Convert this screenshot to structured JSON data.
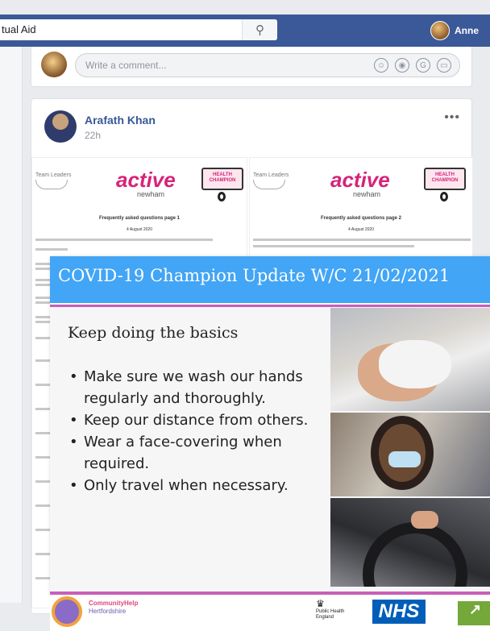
{
  "topbar": {
    "search_value": "tual Aid",
    "search_icon": "search-icon",
    "profile_name": "Anne",
    "color": "#3b5998"
  },
  "comment": {
    "placeholder": "Write a comment...",
    "icons": [
      "emoji-icon",
      "camera-icon",
      "gif-icon",
      "sticker-icon"
    ]
  },
  "post": {
    "author": "Arafath Khan",
    "time": "22h",
    "more": "•••"
  },
  "doc_preview": {
    "brand": "active",
    "brand_sub": "newham",
    "left_logo": "Team Leaders",
    "champion_label": "HEALTH CHAMPION",
    "heading_1": "Frequently asked questions page 1",
    "heading_2": "Frequently asked questions page 2",
    "date": "4 August 2020",
    "brand_color": "#d6247a"
  },
  "slide": {
    "title": "COVID-19 Champion Update W/C 21/02/2021",
    "subtitle": "Keep doing the basics",
    "bullets": [
      "Make sure we wash our hands regularly and thoroughly.",
      "Keep our distance from others.",
      "Wear a face-covering when required.",
      "Only travel when necessary."
    ],
    "header_color": "#42a5f5",
    "accent_color": "#c85fb8"
  },
  "footer": {
    "community_line1": "CommunityHelp",
    "community_line2": "Hertfordshire",
    "phe_line1": "Public Health",
    "phe_line2": "England",
    "nhs": "NHS"
  }
}
